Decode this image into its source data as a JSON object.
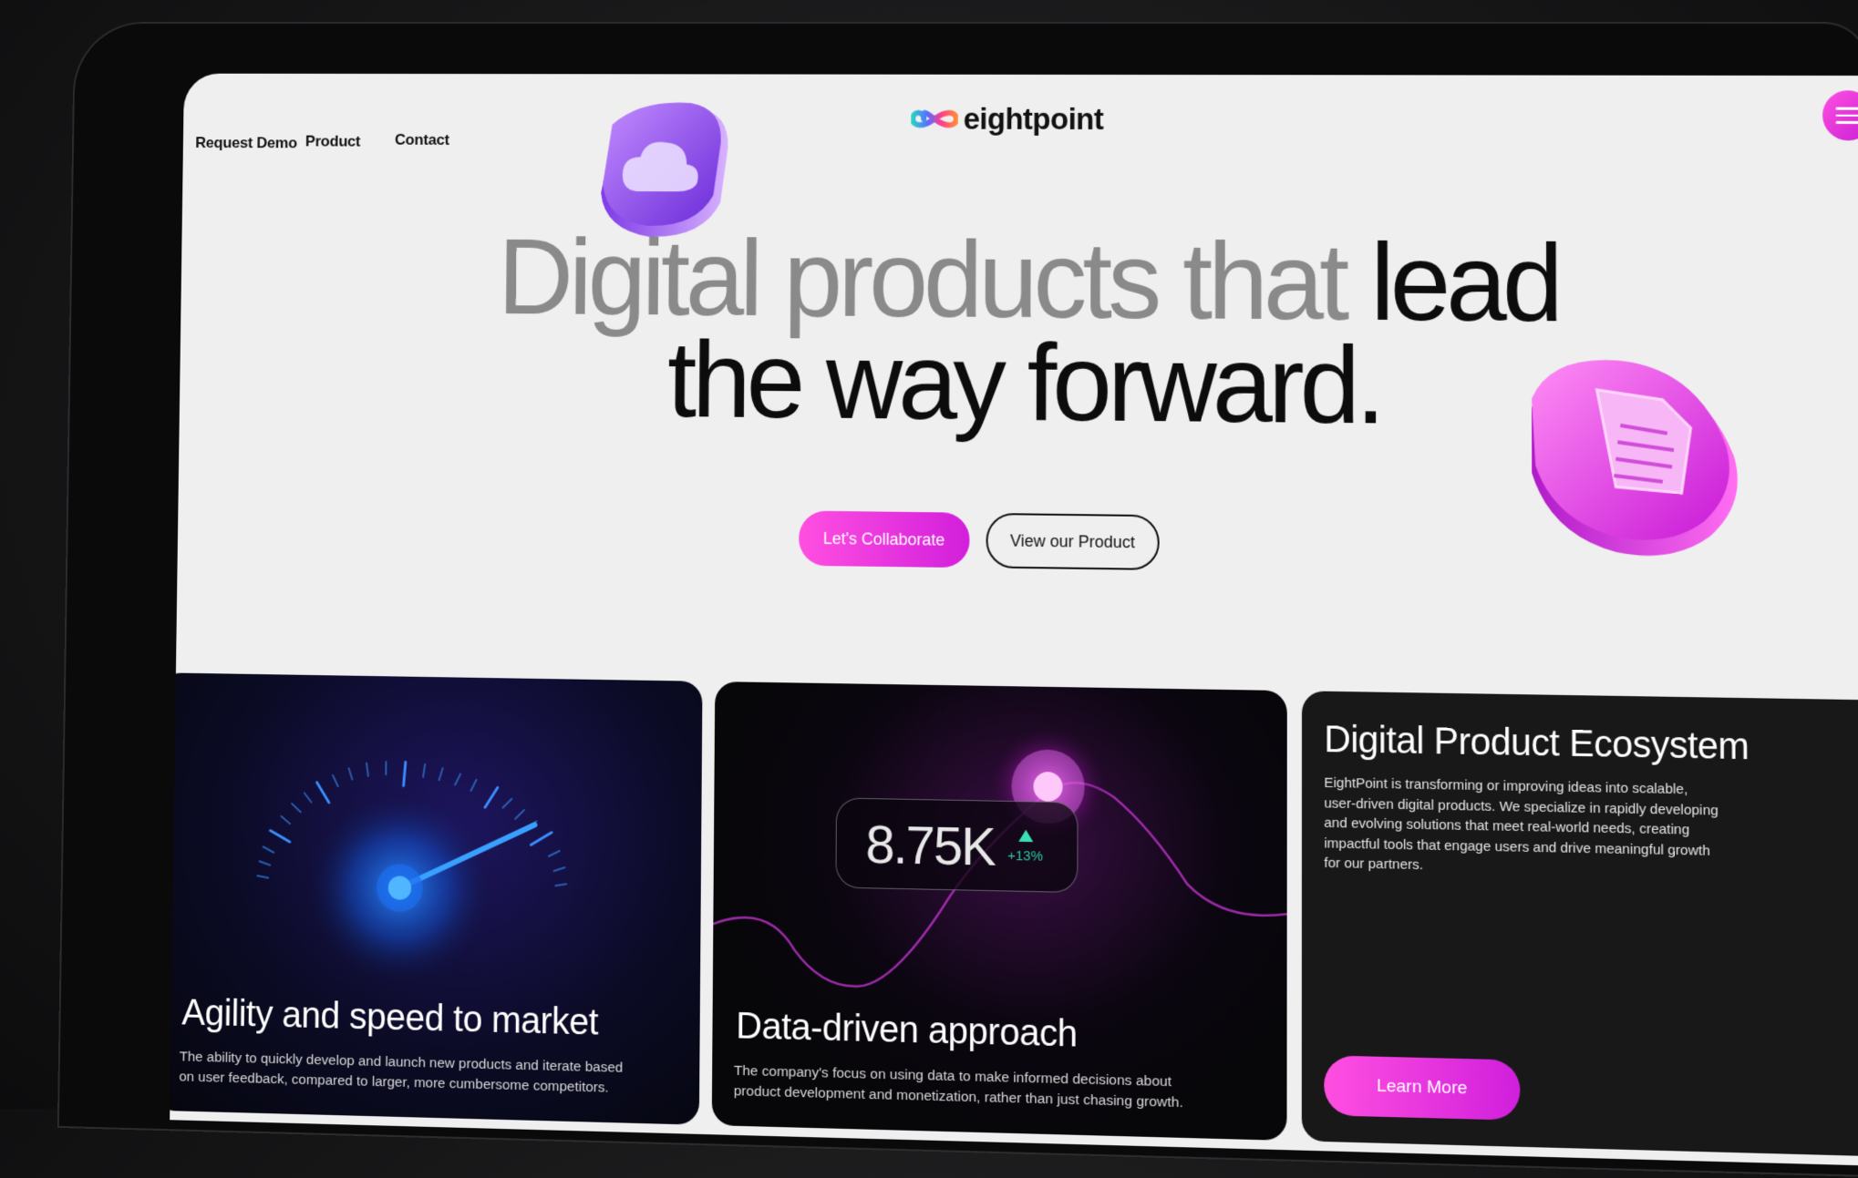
{
  "nav": {
    "links": [
      "Request Demo",
      "Product",
      "Contact"
    ]
  },
  "brand": {
    "name": "eightpoint",
    "accent": "#e23be6",
    "logo_colors": [
      "#ff8a3d",
      "#ff3d8a",
      "#5a6bff",
      "#2ad0c8"
    ]
  },
  "menu": {
    "icon": "hamburger-icon"
  },
  "hero": {
    "line1_grey": "Digital products that",
    "line1_dark": "lead",
    "line2": "the way forward."
  },
  "cta": {
    "primary": "Let's Collaborate",
    "secondary": "View our Product"
  },
  "decor": {
    "cube_left_icon": "cloud-icon",
    "cube_right_icon": "document-icon"
  },
  "cards": [
    {
      "title": "Agility and speed to market",
      "desc_line1": "The ability to quickly develop and launch new products and iterate based",
      "desc_line2": "on user feedback, compared to larger, more cumbersome competitors.",
      "visual": "speedometer-icon",
      "bg_colors": [
        "#1a1050",
        "#05060c"
      ]
    },
    {
      "title": "Data-driven approach",
      "desc_line1": "The company's focus on using data to make informed decisions about",
      "desc_line2": "product development and monetization, rather than just chasing growth.",
      "stat_value": "8.75K",
      "stat_change": "+13%",
      "visual": "line-chart-icon",
      "bg_colors": [
        "#07060a",
        "#5a1560"
      ]
    },
    {
      "title": "Digital Product Ecosystem",
      "desc_lines": [
        "EightPoint is transforming or improving ideas into scalable,",
        "user-driven digital products. We specialize in rapidly developing",
        "and evolving solutions that meet real-world needs, creating",
        "impactful tools that engage users and drive meaningful growth",
        "for our partners."
      ],
      "button": "Learn More",
      "bg_colors": [
        "#181818",
        "#181818"
      ]
    }
  ]
}
